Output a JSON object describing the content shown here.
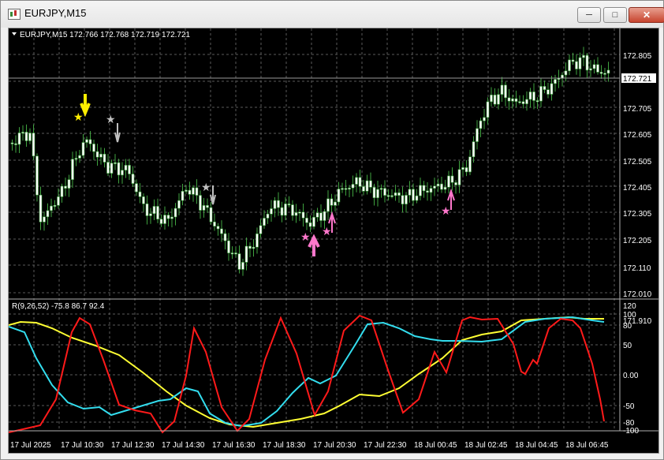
{
  "window": {
    "title": "EURJPY,M15"
  },
  "chart": {
    "symbol_info": "EURJPY,M15  172.766 172.768 172.719 172.721",
    "price_ticks": [
      "172.805",
      "172.705",
      "172.605",
      "172.505",
      "172.405",
      "172.305",
      "172.205",
      "172.110",
      "172.010",
      "171.910"
    ],
    "current_price": "172.721",
    "time_labels": [
      "17 Jul 2025",
      "17 Jul 10:30",
      "17 Jul 12:30",
      "17 Jul 14:30",
      "17 Jul 16:30",
      "17 Jul 18:30",
      "17 Jul 20:30",
      "17 Jul 22:30",
      "18 Jul 00:45",
      "18 Jul 02:45",
      "18 Jul 04:45",
      "18 Jul 06:45"
    ],
    "colors": {
      "candle": "#ffffff",
      "indicator_red": "#ff1a1a",
      "indicator_yellow": "#ffff33",
      "indicator_cyan": "#33ddee",
      "sell_arrow": "#ffee00",
      "grey_arrow": "#c0c0c0",
      "pink_arrow": "#ff77cc"
    }
  },
  "indicator": {
    "label": "R(9,26,52) -75.8 86.7 92.4",
    "ticks": [
      "120",
      "100",
      "80",
      "50",
      "0.00",
      "-50",
      "-80",
      "-100"
    ]
  }
}
